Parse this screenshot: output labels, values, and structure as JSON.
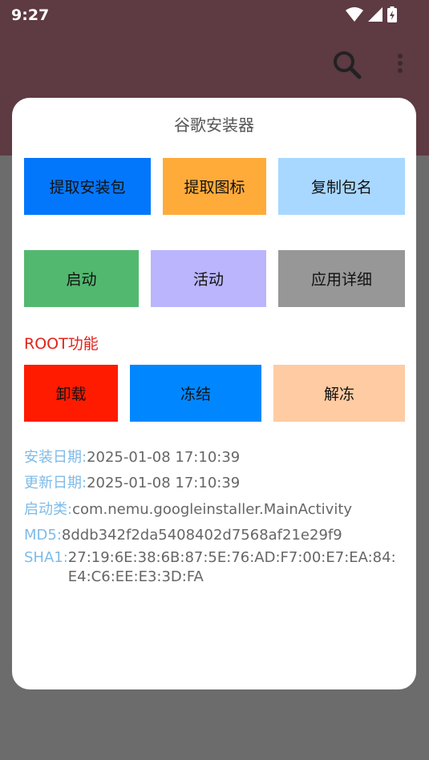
{
  "status_bar": {
    "time": "9:27"
  },
  "colors": {
    "btn_extract_apk": "#0377fc",
    "btn_extract_icon": "#ffab3a",
    "btn_copy_pkg": "#a8d8ff",
    "btn_launch": "#52b86f",
    "btn_activity": "#bab5fc",
    "btn_app_details": "#979797",
    "btn_uninstall": "#ff1b00",
    "btn_freeze": "#0087ff",
    "btn_unfreeze": "#ffcba2",
    "root_label": "#e2231a",
    "info_key": "#7fbbe8"
  },
  "dialog": {
    "title": "谷歌安装器",
    "row1": [
      "提取安装包",
      "提取图标",
      "复制包名"
    ],
    "row2": [
      "启动",
      "活动",
      "应用详细"
    ],
    "root_label": "ROOT功能",
    "row3": [
      "卸载",
      "冻结",
      "解冻"
    ],
    "info": {
      "install_date_key": "安装日期:",
      "install_date_val": "2025-01-08 17:10:39",
      "update_date_key": "更新日期:",
      "update_date_val": "2025-01-08 17:10:39",
      "launch_class_key": "启动类:",
      "launch_class_val": "com.nemu.googleinstaller.MainActivity",
      "md5_key": "MD5:",
      "md5_val": "8ddb342f2da5408402d7568af21e29f9",
      "sha1_key": "SHA1:",
      "sha1_val": "27:19:6E:38:6B:87:5E:76:AD:F7:00:E7:EA:84:E4:C6:EE:E3:3D:FA"
    }
  }
}
